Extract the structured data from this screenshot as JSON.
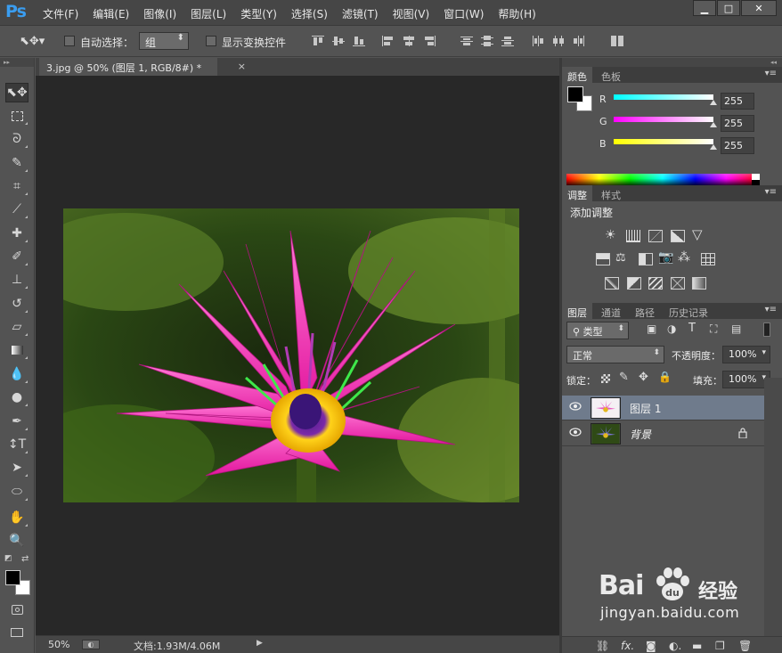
{
  "app": {
    "logo": "Ps",
    "menus": [
      "文件(F)",
      "编辑(E)",
      "图像(I)",
      "图层(L)",
      "类型(Y)",
      "选择(S)",
      "滤镜(T)",
      "视图(V)",
      "窗口(W)",
      "帮助(H)"
    ],
    "window_controls": {
      "minimize": "▁",
      "maximize": "□",
      "close": "✕"
    }
  },
  "options": {
    "auto_select_label": "自动选择：",
    "auto_select_value": "组",
    "show_transform_label": "显示变换控件"
  },
  "document": {
    "tab_title": "3.jpg @ 50% (图层 1, RGB/8#) *",
    "tab_close": "×",
    "zoom": "50%",
    "doc_size": "文档:1.93M/4.06M"
  },
  "color_panel": {
    "tabs": [
      "颜色",
      "色板"
    ],
    "channels": [
      {
        "label": "R",
        "value": "255"
      },
      {
        "label": "G",
        "value": "255"
      },
      {
        "label": "B",
        "value": "255"
      }
    ]
  },
  "adjust_panel": {
    "tabs": [
      "调整",
      "样式"
    ],
    "title": "添加调整"
  },
  "layers_panel": {
    "tabs": [
      "图层",
      "通道",
      "路径",
      "历史记录"
    ],
    "filter_kind": "类型",
    "blend_mode": "正常",
    "opacity_label": "不透明度：",
    "opacity_value": "100%",
    "lock_label": "锁定：",
    "fill_label": "填充：",
    "fill_value": "100%",
    "layers": [
      {
        "name": "图层 1",
        "selected": true
      },
      {
        "name": "背景",
        "selected": false,
        "locked": true
      }
    ]
  },
  "watermark": {
    "brand": "Bai",
    "brand_suffix": "经验",
    "url": "jingyan.baidu.com"
  }
}
